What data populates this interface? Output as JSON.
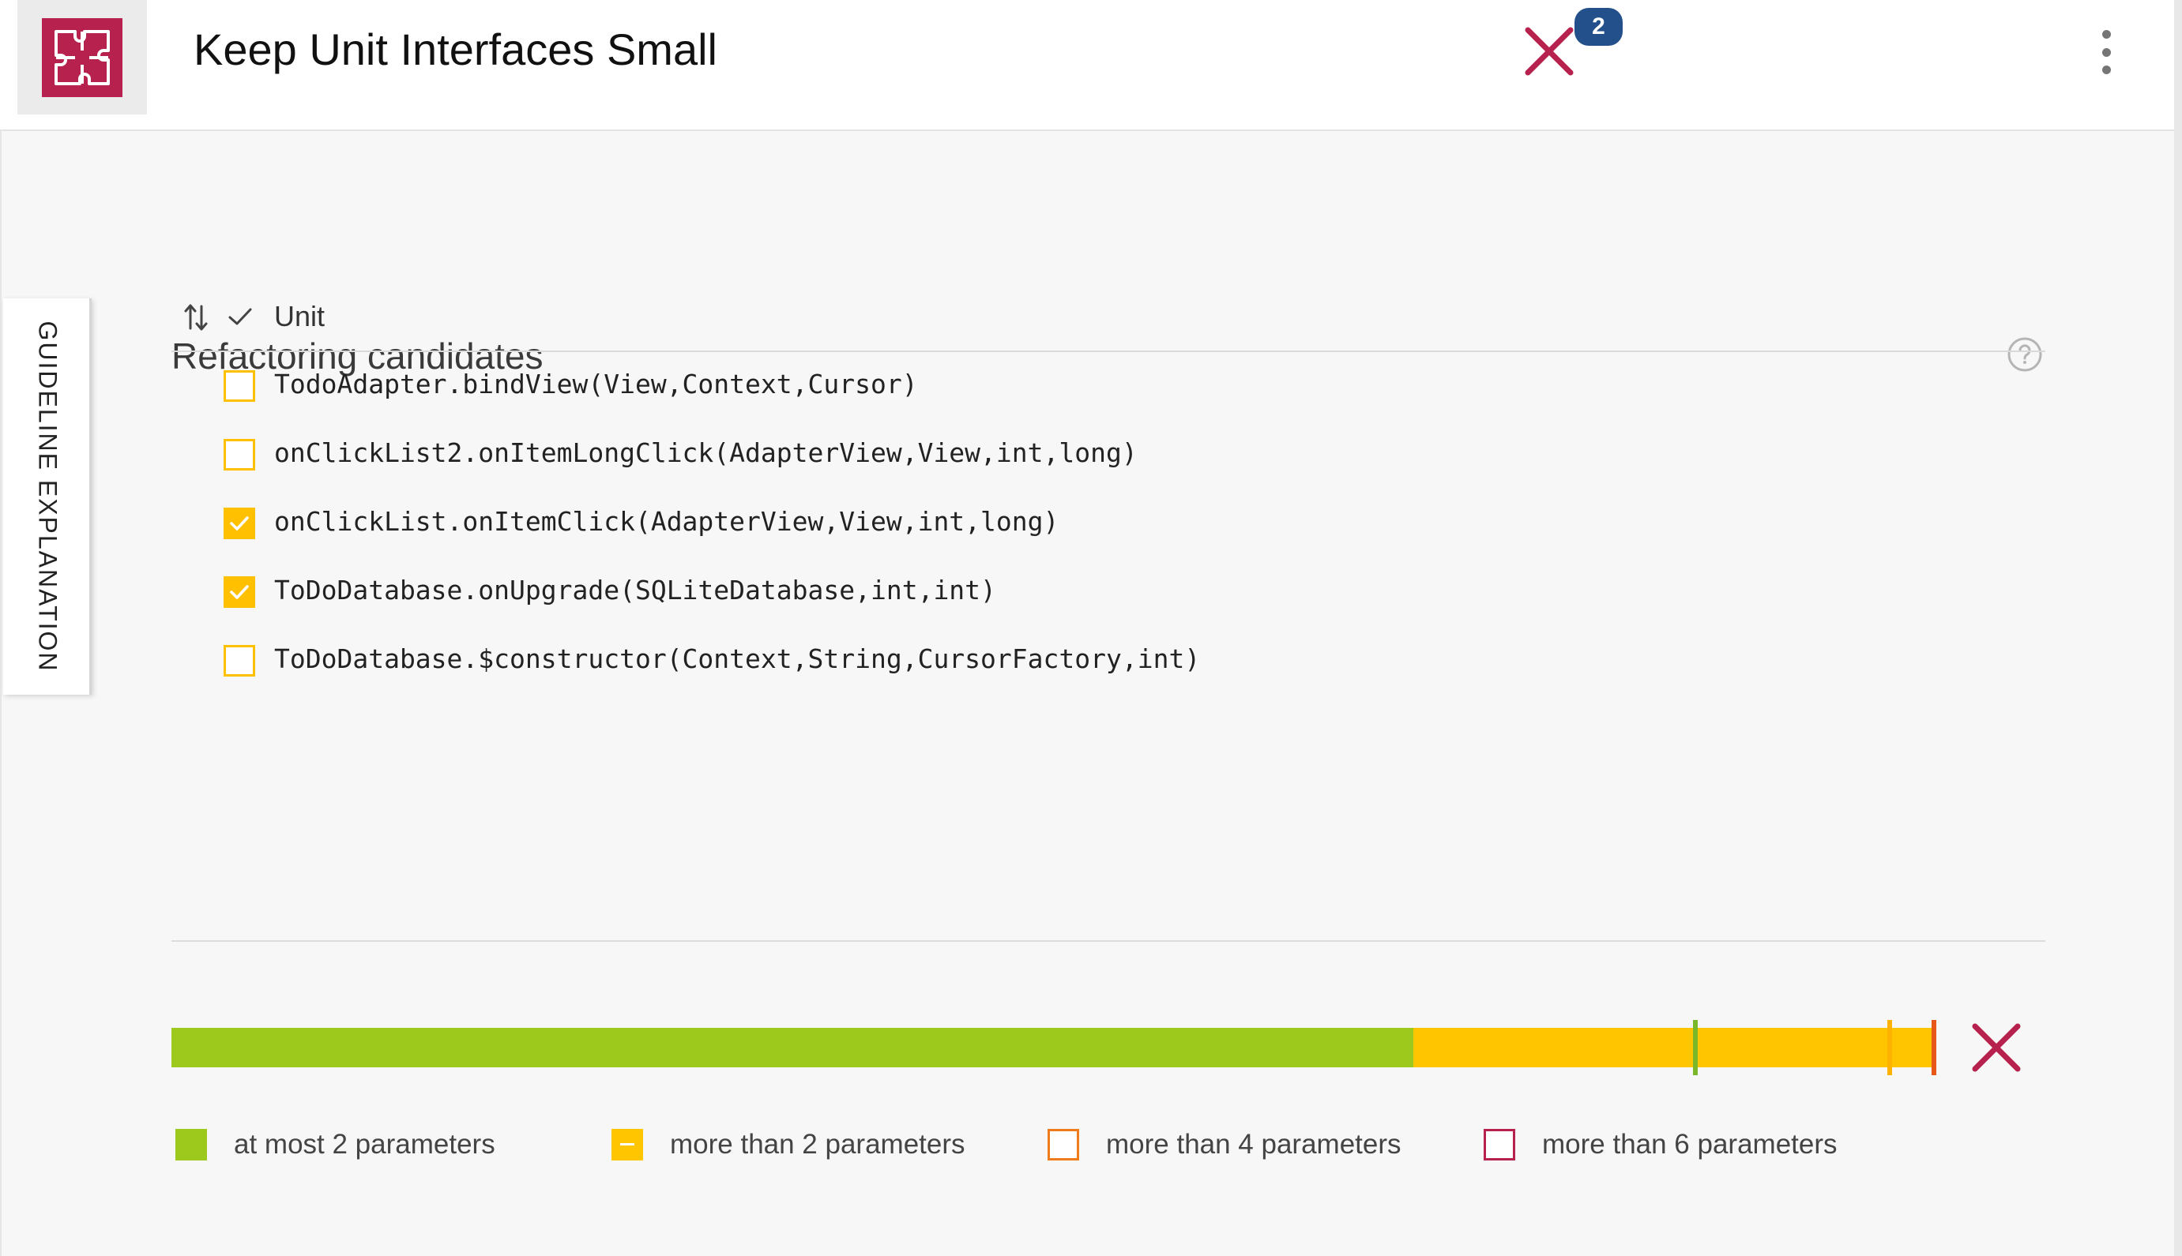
{
  "header": {
    "title": "Keep Unit Interfaces Small",
    "logo_icon": "puzzle-icon",
    "status_icon": "x-mark-icon",
    "badge_count": "2",
    "menu_icon": "more-vertical-icon"
  },
  "side_tab": {
    "label": "GUIDELINE EXPLANATION"
  },
  "section": {
    "title": "Refactoring candidates",
    "help_icon": "help-circle-icon"
  },
  "table": {
    "sort_icon": "sort-arrows-icon",
    "check_icon": "checkmark-icon",
    "column_unit": "Unit",
    "rows": [
      {
        "unit": "TodoAdapter.bindView(View,Context,Cursor)",
        "checked": false
      },
      {
        "unit": "onClickList2.onItemLongClick(AdapterView,View,int,long)",
        "checked": false
      },
      {
        "unit": "onClickList.onItemClick(AdapterView,View,int,long)",
        "checked": true
      },
      {
        "unit": "ToDoDatabase.onUpgrade(SQLiteDatabase,int,int)",
        "checked": true
      },
      {
        "unit": "ToDoDatabase.$constructor(Context,String,CursorFactory,int)",
        "checked": false
      }
    ]
  },
  "distribution": {
    "segments": [
      {
        "category": "at most 2 parameters",
        "fraction": 0.704,
        "color": "#9dc81c"
      },
      {
        "category": "more than 2 parameters",
        "fraction": 0.296,
        "color": "#ffc600"
      }
    ],
    "thresholds": [
      {
        "position": 0.864,
        "color": "#7ab829"
      },
      {
        "position": 0.974,
        "color": "#ffb300"
      },
      {
        "position": 0.999,
        "color": "#e6571a"
      }
    ],
    "status_icon": "x-mark-icon"
  },
  "legend": [
    {
      "label": "at most 2 parameters",
      "color": "#9dc81c",
      "style": "filled"
    },
    {
      "label": "more than 2 parameters",
      "color": "#ffc600",
      "style": "dash"
    },
    {
      "label": "more than 4 parameters",
      "color": "#f07b1a",
      "style": "outline"
    },
    {
      "label": "more than 6 parameters",
      "color": "#b6224d",
      "style": "outline"
    }
  ],
  "colors": {
    "brand": "#b6224d",
    "badge": "#23508a",
    "checkbox": "#ffc000"
  }
}
